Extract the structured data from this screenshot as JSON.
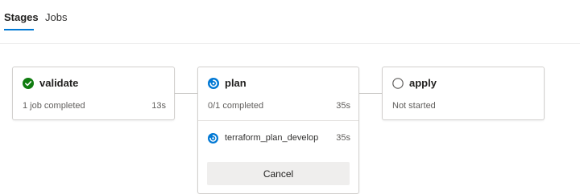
{
  "tabs": {
    "stages": "Stages",
    "jobs": "Jobs",
    "active": "Stages"
  },
  "stages": [
    {
      "name": "validate",
      "status": "succeeded",
      "summary": "1 job completed",
      "duration": "13s"
    },
    {
      "name": "plan",
      "status": "running",
      "summary": "0/1 completed",
      "duration": "35s",
      "jobs": [
        {
          "name": "terraform_plan_develop",
          "status": "running",
          "duration": "35s"
        }
      ],
      "cancel_label": "Cancel"
    },
    {
      "name": "apply",
      "status": "not-started",
      "summary": "Not started"
    }
  ],
  "colors": {
    "accent": "#0078d4",
    "success": "#107c10",
    "running": "#0078d4",
    "pending": "#605e5c"
  }
}
